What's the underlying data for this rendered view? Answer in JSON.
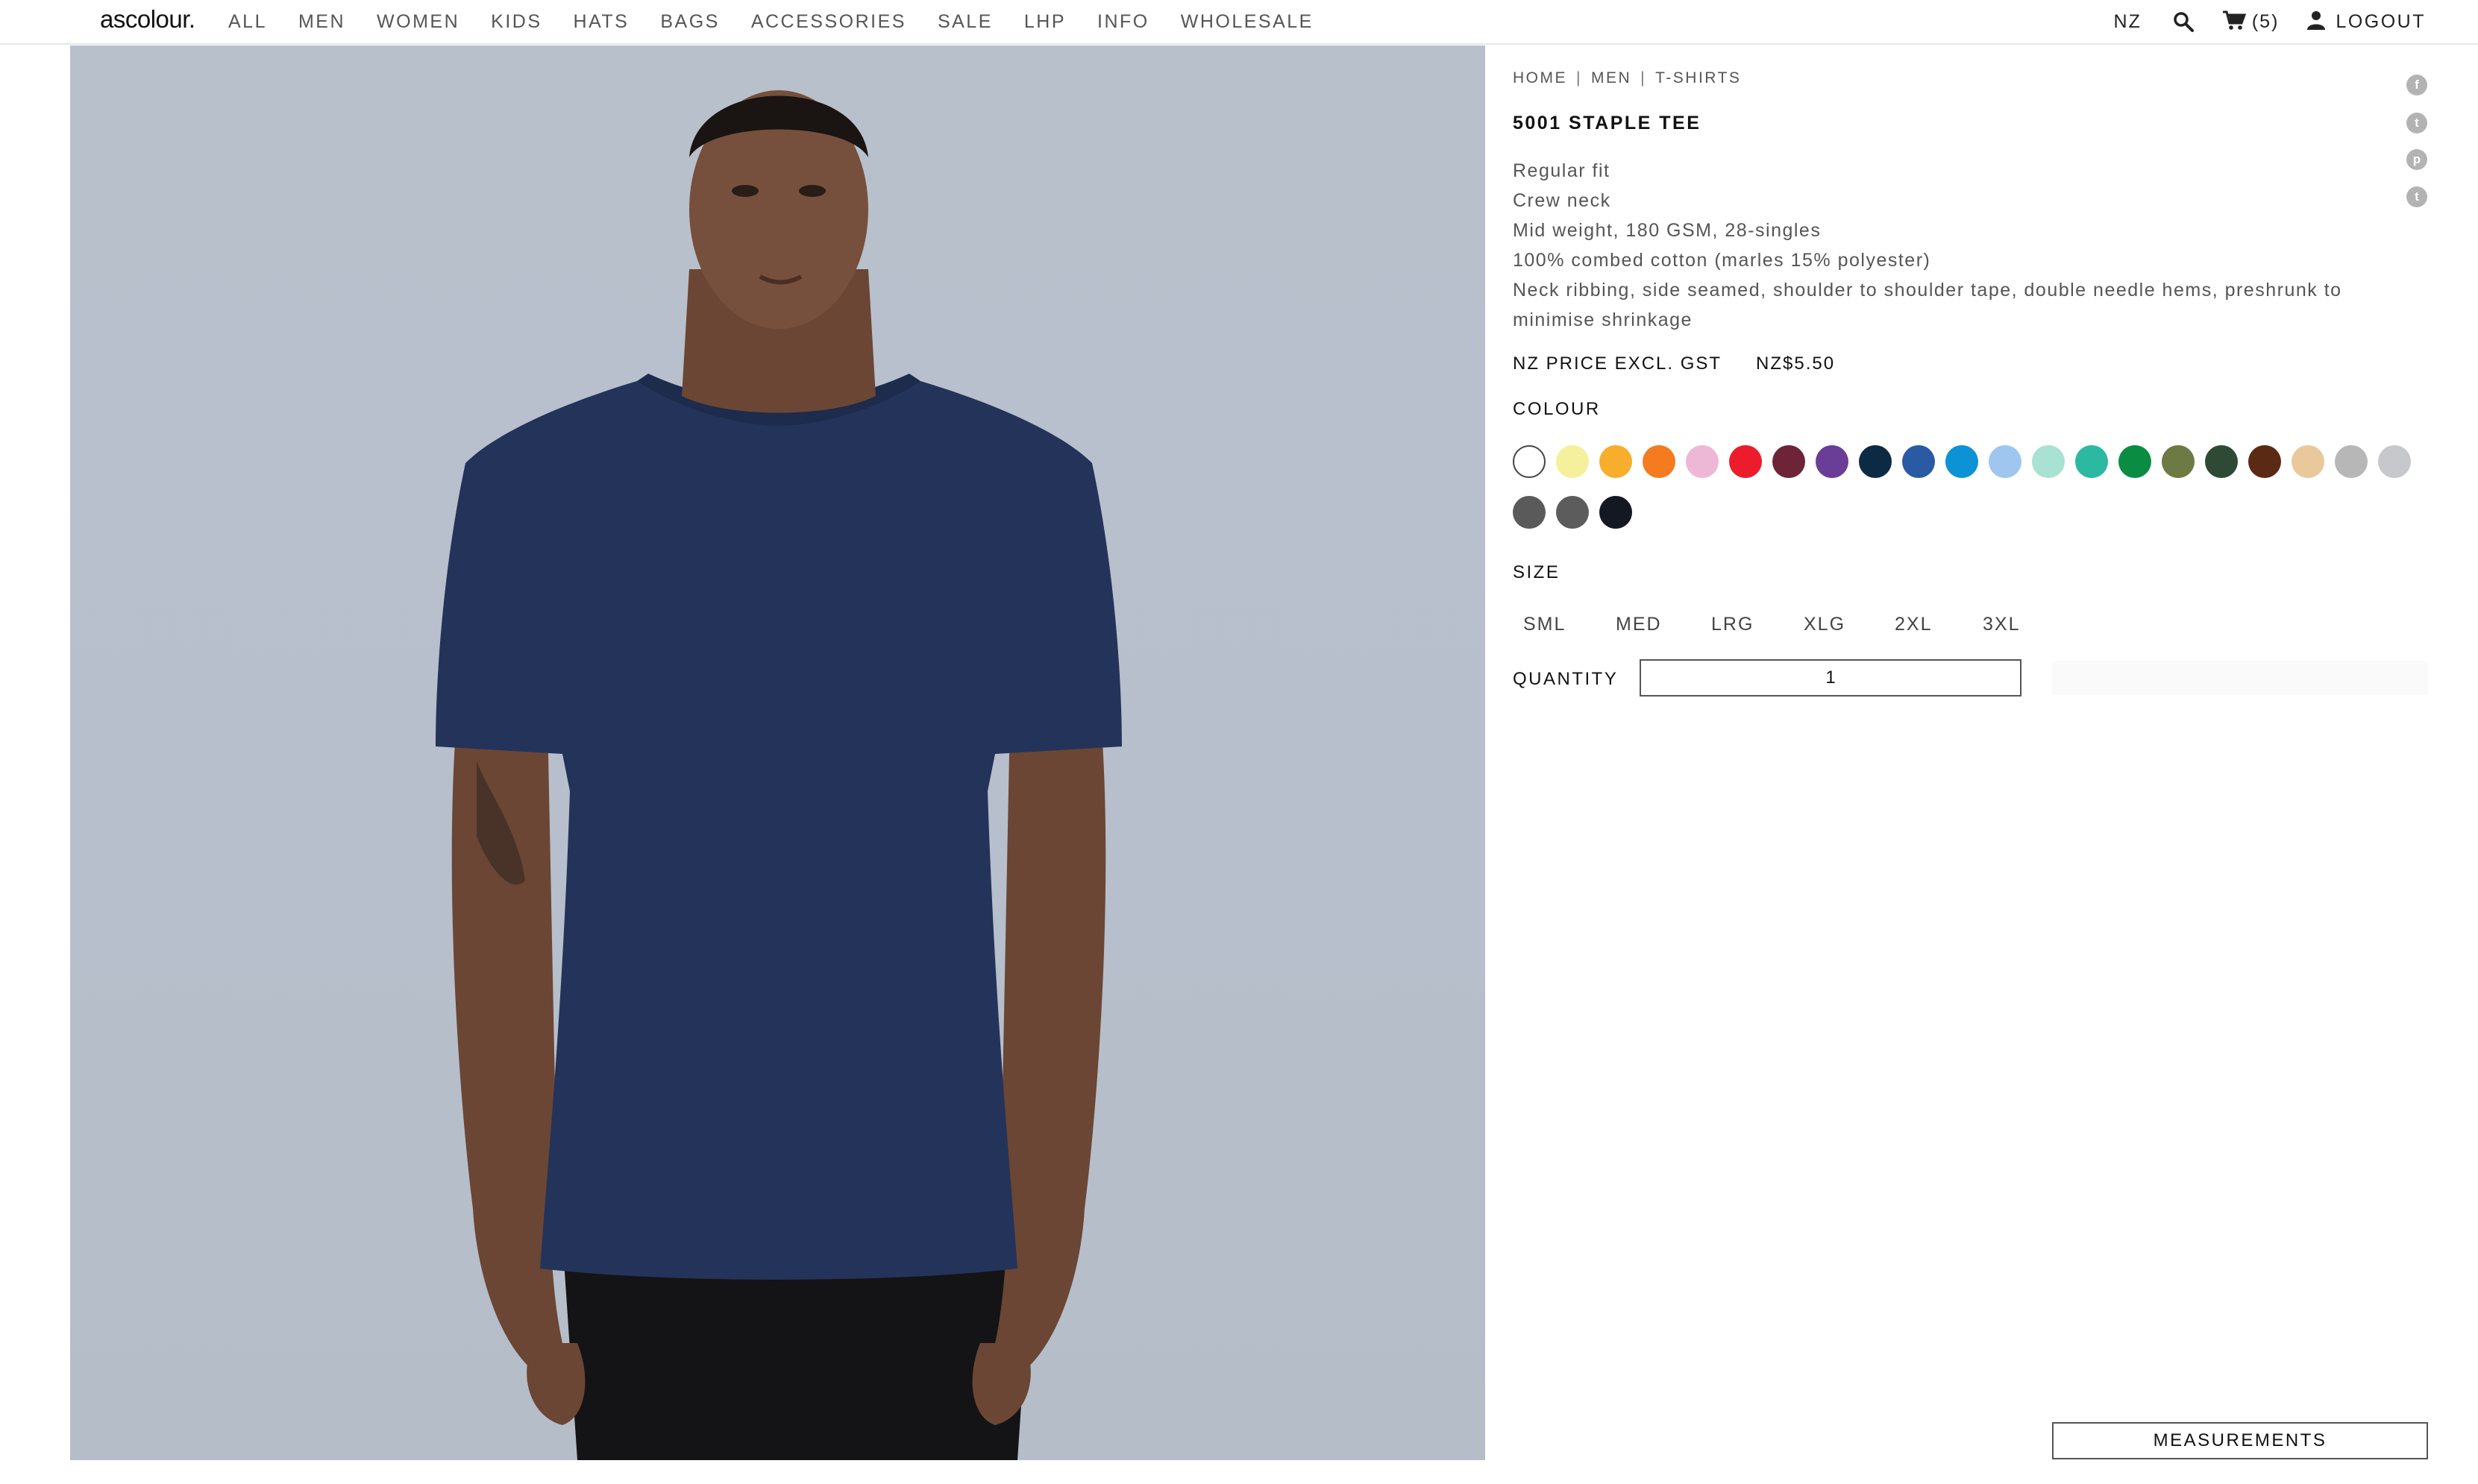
{
  "header": {
    "logo": "ascolour.",
    "nav": [
      "ALL",
      "MEN",
      "WOMEN",
      "KIDS",
      "HATS",
      "BAGS",
      "ACCESSORIES",
      "SALE",
      "LHP",
      "INFO",
      "WHOLESALE"
    ],
    "region": "NZ",
    "search_icon": "search-icon",
    "cart_icon": "cart-icon",
    "cart_count": "(5)",
    "user_icon": "user-icon",
    "logout": "LOGOUT"
  },
  "breadcrumb": [
    "HOME",
    "MEN",
    "T-SHIRTS"
  ],
  "product": {
    "title": "5001 STAPLE TEE",
    "features": [
      "Regular fit",
      "Crew neck",
      "Mid weight, 180 GSM, 28-singles",
      "100% combed cotton (marles 15% polyester)",
      "Neck ribbing, side seamed, shoulder to shoulder tape, double needle hems, preshrunk to minimise shrinkage"
    ],
    "price_label": "NZ PRICE EXCL. GST",
    "price": "NZ$5.50",
    "colour_label": "COLOUR",
    "colours": [
      "#ffffff",
      "#f5f09c",
      "#f8ae2c",
      "#f47b20",
      "#edb8d6",
      "#ec1c2c",
      "#6d2438",
      "#6a3d97",
      "#0d2a45",
      "#2b5aa4",
      "#0c93d6",
      "#9fc6ee",
      "#a9e1d3",
      "#2bb9a2",
      "#0a8d43",
      "#6e7a43",
      "#2e4a35",
      "#5a2a14",
      "#e9c99c",
      "#b7b7b7",
      "#c6c8cb",
      "#5a5a5a",
      "#5c5c5c",
      "#141822"
    ],
    "size_label": "SIZE",
    "sizes": [
      "SML",
      "MED",
      "LRG",
      "XLG",
      "2XL",
      "3XL"
    ],
    "quantity_label": "QUANTITY",
    "quantity": "1",
    "measurements": "MEASUREMENTS"
  },
  "social": [
    "facebook-icon",
    "twitter-icon",
    "pinterest-icon",
    "tumblr-icon"
  ],
  "social_glyphs": [
    "f",
    "t",
    "p",
    "t"
  ]
}
